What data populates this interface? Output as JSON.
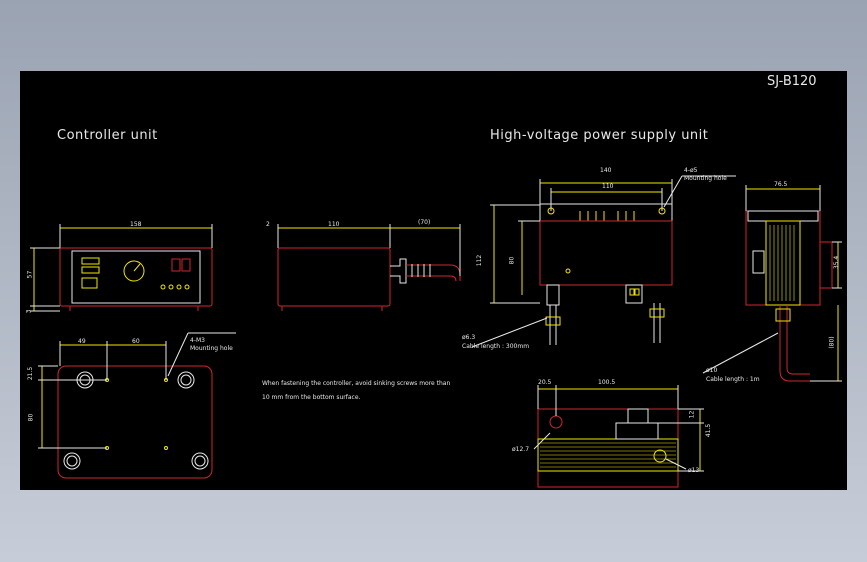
{
  "drawing_id": "SJ-B120",
  "titles": {
    "controller": "Controller unit",
    "hv_supply": "High-voltage power supply unit"
  },
  "controller_front": {
    "width": "158",
    "height": "57",
    "base": "3"
  },
  "controller_side": {
    "offset": "2",
    "depth": "110",
    "cable": "(70)"
  },
  "controller_bottom": {
    "dim_a": "49",
    "dim_b": "60",
    "dim_c": "21.5",
    "dim_d": "80",
    "holes": "4-M3",
    "holes_note": "Mounting hole"
  },
  "note": {
    "line1": "When fastening the controller, avoid sinking screws more than",
    "line2": "10 mm from the bottom surface."
  },
  "hv_front": {
    "width": "140",
    "pitch": "110",
    "holes": "4-ø5",
    "holes_note": "Mounting hole",
    "height": "112",
    "hole_pitch": "80",
    "cable_dia": "ø6.3",
    "cable_len": "Cable length : 300mm"
  },
  "hv_side": {
    "depth": "76.5",
    "height": "35.4",
    "cable_extra": "(80)",
    "cable_dia": "ø10",
    "cable_len": "Cable length : 1m"
  },
  "hv_top": {
    "dim_a": "20.5",
    "dim_b": "100.5",
    "dim_c": "12",
    "dim_d": "41.5",
    "dia_a": "ø12.7",
    "dia_b": "ø13"
  }
}
